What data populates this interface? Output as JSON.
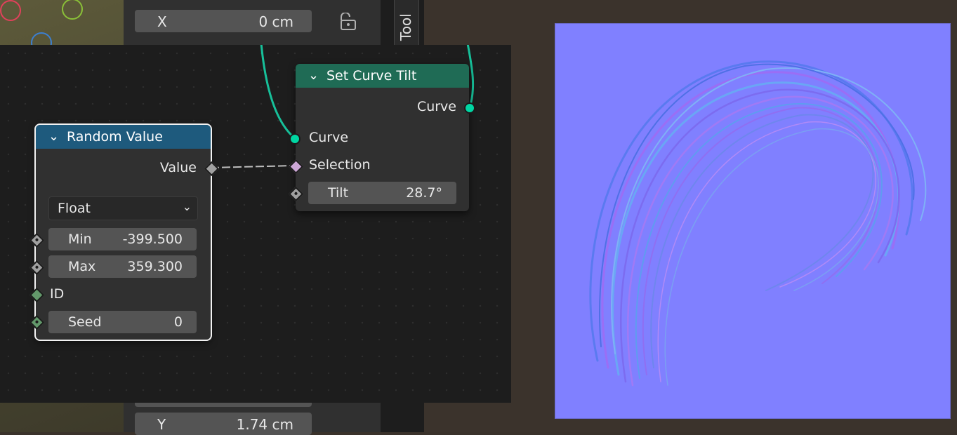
{
  "transform_panel": {
    "x_label": "X",
    "x_value": "0 cm",
    "y_label": "Y",
    "y_value": "1.74 cm"
  },
  "sidebar_tab": {
    "tool_label": "Tool"
  },
  "random_value_node": {
    "title": "Random Value",
    "output_value_label": "Value",
    "data_type": "Float",
    "min_label": "Min",
    "min_value": "-399.500",
    "max_label": "Max",
    "max_value": "359.300",
    "id_label": "ID",
    "seed_label": "Seed",
    "seed_value": "0",
    "header_color": "#1e5a7d"
  },
  "set_curve_tilt_node": {
    "title": "Set Curve Tilt",
    "output_curve_label": "Curve",
    "input_curve_label": "Curve",
    "selection_label": "Selection",
    "tilt_label": "Tilt",
    "tilt_value": "28.7°",
    "header_color": "#1f6b55"
  },
  "colors": {
    "geometry_socket": "#00d6a3",
    "float_socket": "#a0a0a0",
    "bool_socket": "#cca6d6",
    "int_socket": "#63996b",
    "normal_map_bg": "#8080ff"
  }
}
